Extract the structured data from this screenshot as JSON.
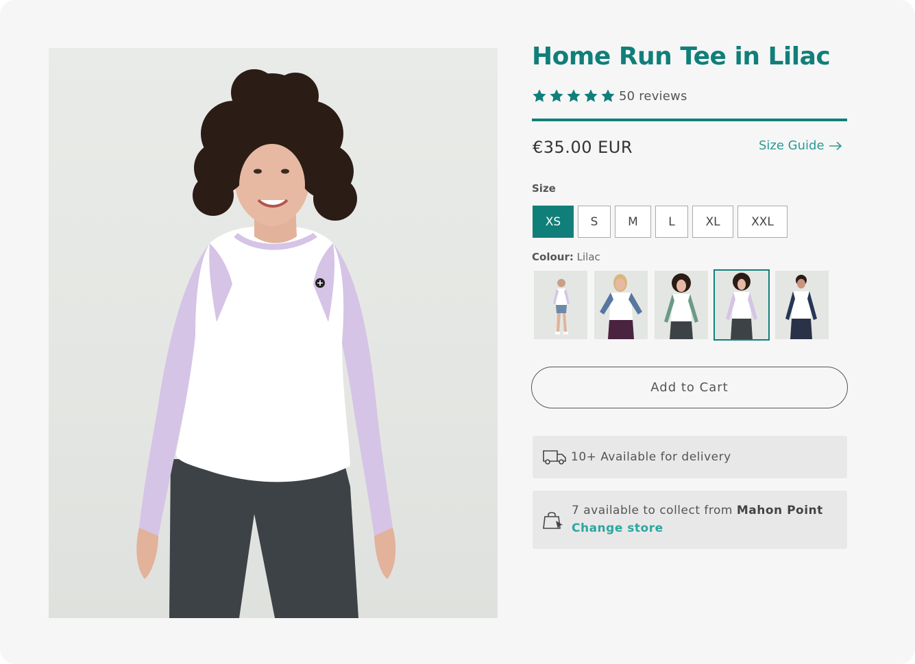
{
  "product": {
    "title": "Home Run Tee in Lilac",
    "rating": 5,
    "reviews_label": "50 reviews",
    "price": "€35.00 EUR",
    "size_guide_label": "Size Guide",
    "size_label": "Size",
    "sizes": [
      "XS",
      "S",
      "M",
      "L",
      "XL",
      "XXL"
    ],
    "selected_size": "XS",
    "colour_label": "Colour:",
    "colour_value": "Lilac",
    "colour_swatches": [
      "Lilac (shorts)",
      "Blue",
      "Green",
      "Lilac",
      "Navy"
    ],
    "selected_swatch": 3,
    "add_to_cart_label": "Add to Cart"
  },
  "availability": {
    "delivery_text": "10+ Available for delivery",
    "collect_prefix": "7 available to collect from",
    "collect_store": "Mahon Point",
    "change_store_label": "Change store"
  },
  "icons": {
    "star": "star-icon",
    "arrow": "arrow-right-icon",
    "truck": "truck-icon",
    "bag": "shopping-bag-icon"
  },
  "colors": {
    "brand": "#107f7a",
    "link": "#2aa79f",
    "background": "#f6f6f6",
    "lilac": "#d8c7e8"
  }
}
